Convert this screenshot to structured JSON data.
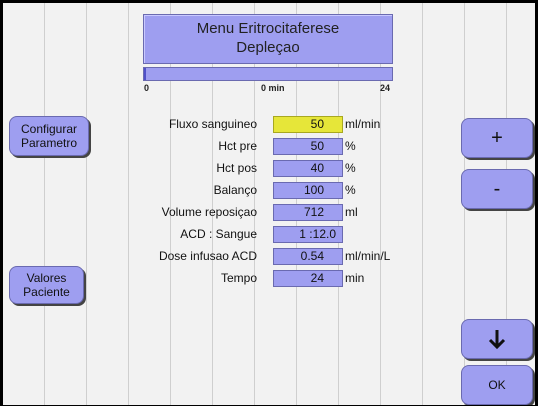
{
  "header": {
    "title_line1": "Menu Eritrocitaferese",
    "title_line2": "Depleçao"
  },
  "progress": {
    "value_fraction": 0.0,
    "scale_start": "0",
    "scale_mid": "0 min",
    "scale_end": "24"
  },
  "left_buttons": {
    "configure_line1": "Configurar",
    "configure_line2": "Parametro",
    "patient_line1": "Valores",
    "patient_line2": "Paciente"
  },
  "right_buttons": {
    "plus_label": "+",
    "minus_label": "-",
    "down_icon": "arrow-down-icon",
    "ok_label": "OK"
  },
  "params": [
    {
      "label": "Fluxo sanguineo",
      "value": "50",
      "unit": "ml/min"
    },
    {
      "label": "Hct pre",
      "value": "50",
      "unit": "%"
    },
    {
      "label": "Hct pos",
      "value": "40",
      "unit": "%"
    },
    {
      "label": "Balanço",
      "value": "100",
      "unit": "%"
    },
    {
      "label": "Volume reposiçao",
      "value": "712",
      "unit": "ml"
    },
    {
      "label": "ACD : Sangue",
      "value": "1 :12.0",
      "unit": ""
    },
    {
      "label": "Dose infusao ACD",
      "value": "0.54",
      "unit": "ml/min/L"
    },
    {
      "label": "Tempo",
      "value": "24",
      "unit": "min"
    }
  ],
  "colors": {
    "button_fill": "#9e9ef0",
    "active_field": "#e6e639",
    "background": "#f2f2f2"
  }
}
